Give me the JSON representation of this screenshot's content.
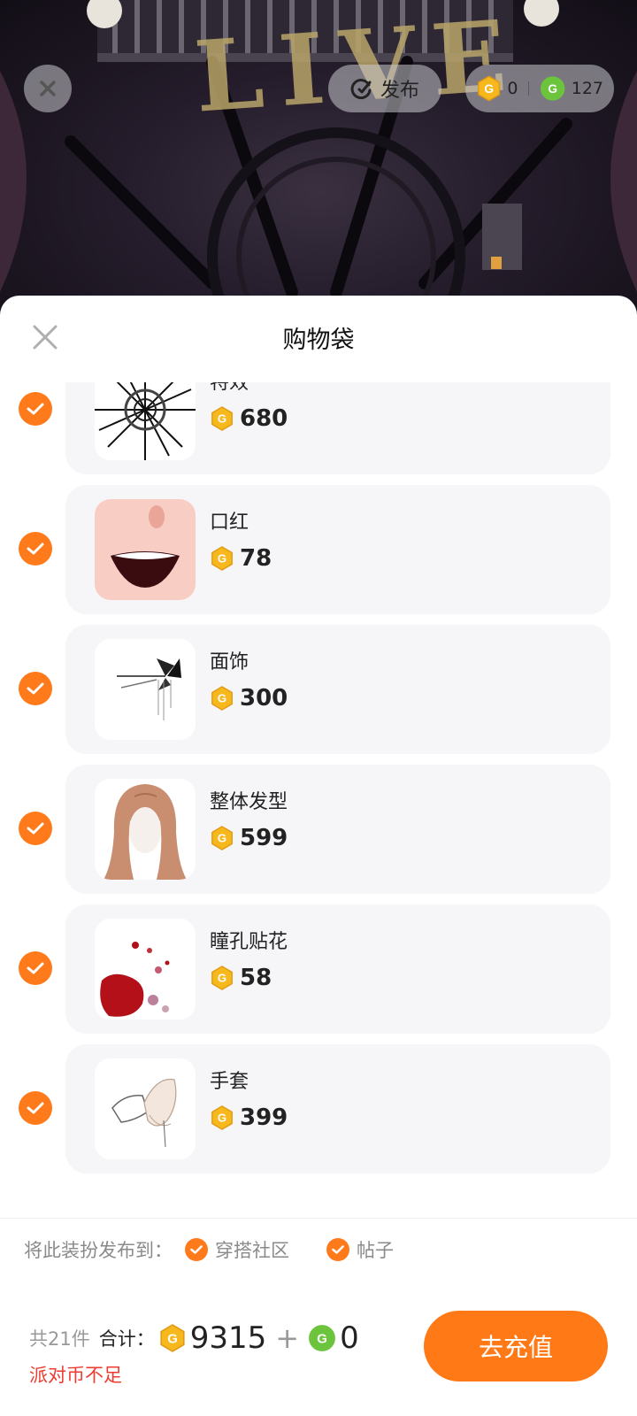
{
  "top_bar": {
    "publish_label": "发布",
    "gold_balance": "0",
    "green_balance": "127"
  },
  "scene": {
    "sign_text": "LIVE"
  },
  "sheet": {
    "title": "购物袋",
    "items": [
      {
        "name": "特效",
        "price": "680",
        "icon": "effect-burst-icon"
      },
      {
        "name": "口红",
        "price": "78",
        "icon": "lips-icon"
      },
      {
        "name": "面饰",
        "price": "300",
        "icon": "butterfly-face-icon"
      },
      {
        "name": "整体发型",
        "price": "599",
        "icon": "hairstyle-icon"
      },
      {
        "name": "瞳孔贴花",
        "price": "58",
        "icon": "pupil-sticker-icon"
      },
      {
        "name": "手套",
        "price": "399",
        "icon": "glove-icon"
      }
    ],
    "share": {
      "label": "将此装扮发布到：",
      "options": [
        "穿搭社区",
        "帖子"
      ]
    }
  },
  "bottom": {
    "count_text": "共21件",
    "total_label": "合计：",
    "gold_total": "9315",
    "plus": "+",
    "green_total": "0",
    "warning": "派对币不足",
    "recharge_label": "去充值"
  },
  "colors": {
    "accent": "#ff7a1a",
    "warning": "#ee3b2f",
    "gold_coin": "#f7b81d",
    "green_coin": "#6cc43c",
    "card": "#f6f6f9"
  }
}
